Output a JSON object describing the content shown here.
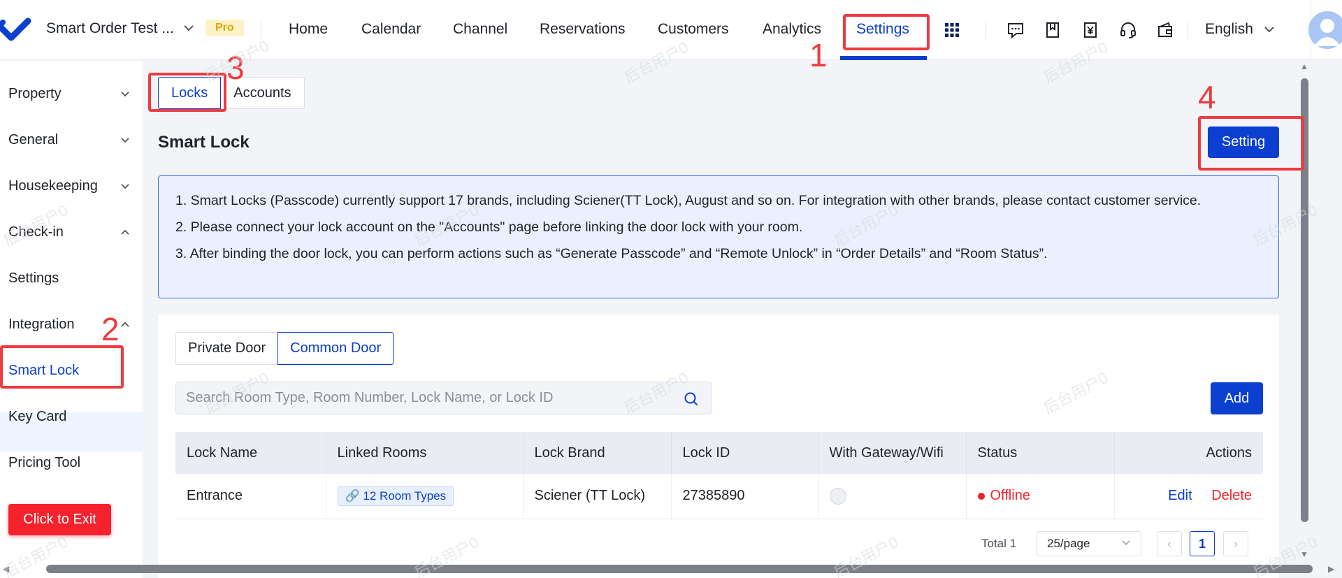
{
  "header": {
    "property_name": "Smart Order Test ...",
    "plan_badge": "Pro",
    "nav": [
      {
        "label": "Home"
      },
      {
        "label": "Calendar"
      },
      {
        "label": "Channel"
      },
      {
        "label": "Reservations"
      },
      {
        "label": "Customers"
      },
      {
        "label": "Analytics"
      },
      {
        "label": "Settings",
        "active": true
      }
    ],
    "language": "English",
    "icons": [
      "apps-grid-icon",
      "message-icon",
      "bookmark-icon",
      "invoice-yen-icon",
      "headset-icon",
      "wallet-icon",
      "avatar"
    ]
  },
  "sidebar": {
    "items": [
      {
        "label": "Property",
        "chevron": "down"
      },
      {
        "label": "General",
        "chevron": "down"
      },
      {
        "label": "Housekeeping",
        "chevron": "down"
      },
      {
        "label": "Check-in",
        "chevron": "up"
      },
      {
        "label": "Settings"
      },
      {
        "label": "Integration",
        "chevron": "up"
      },
      {
        "label": "Smart Lock",
        "active": true
      },
      {
        "label": "Key Card"
      },
      {
        "label": "Pricing Tool"
      }
    ],
    "exit_label": "Click to Exit"
  },
  "main": {
    "tabs": [
      {
        "label": "Locks",
        "active": true
      },
      {
        "label": "Accounts"
      }
    ],
    "title": "Smart Lock",
    "setting_label": "Setting",
    "info_lines": [
      "1. Smart Locks (Passcode) currently support 17 brands, including Sciener(TT Lock), August and so on. For integration with other brands, please contact customer service.",
      "2. Please connect your lock account on the \"Accounts\" page before linking the door lock with your room.",
      "3. After binding the door lock, you can perform actions such as “Generate Passcode” and “Remote Unlock” in “Order Details” and “Room Status”."
    ],
    "door_tabs": [
      {
        "label": "Private Door"
      },
      {
        "label": "Common Door",
        "active": true
      }
    ],
    "search_placeholder": "Search Room Type, Room Number, Lock Name, or Lock ID",
    "add_label": "Add",
    "table": {
      "columns": [
        "Lock Name",
        "Linked Rooms",
        "Lock Brand",
        "Lock ID",
        "With Gateway/Wifi",
        "Status",
        "Actions"
      ],
      "rows": [
        {
          "lock_name": "Entrance",
          "linked_rooms": "12 Room Types",
          "lock_brand": "Sciener (TT Lock)",
          "lock_id": "27385890",
          "gateway": false,
          "status": "Offline",
          "actions": [
            "Edit",
            "Delete"
          ]
        }
      ]
    },
    "pagination": {
      "total": "Total 1",
      "page_size": "25/page",
      "current_page": "1"
    }
  },
  "annotations": [
    "1",
    "2",
    "3",
    "4"
  ],
  "watermark": "后台用户0",
  "colors": {
    "primary": "#0b3fcf",
    "danger": "#f5222d",
    "annotation": "#ee3b40",
    "badge_bg": "#fdf1c7",
    "badge_text": "#e0a80b"
  }
}
